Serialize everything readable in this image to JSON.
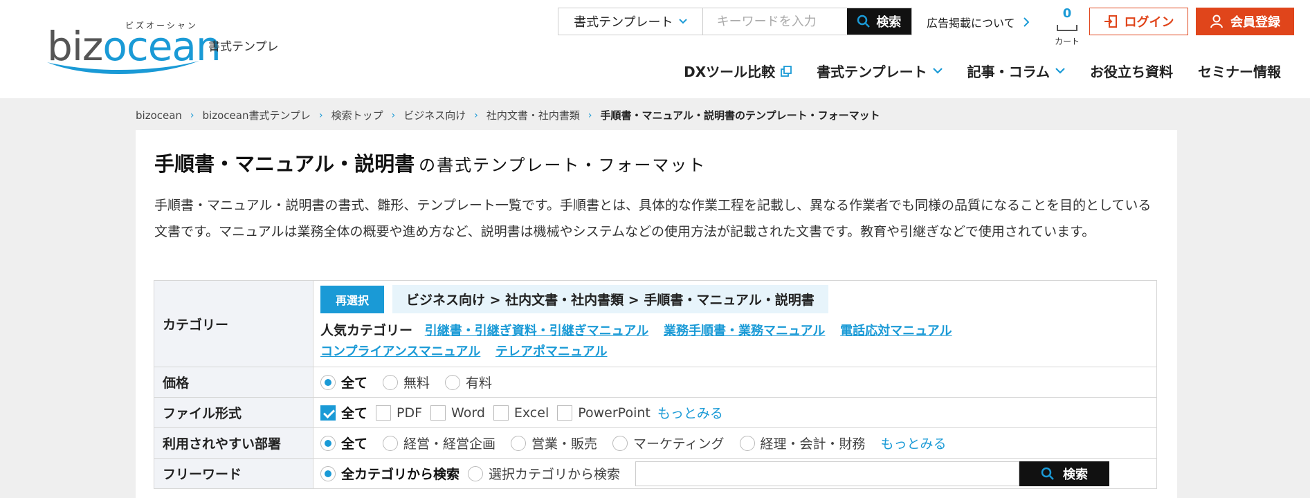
{
  "header": {
    "logo_kana": "ビズオーシャン",
    "logo_text_a": "biz",
    "logo_text_b": "ocean",
    "site_sub": "書式テンプレ",
    "search": {
      "select_label": "書式テンプレート",
      "placeholder": "キーワードを入力",
      "button_label": "検索"
    },
    "ad_link": "広告掲載について",
    "cart": {
      "count": "0",
      "label": "カート"
    },
    "login_label": "ログイン",
    "register_label": "会員登録",
    "nav": [
      {
        "label": "DXツール比較"
      },
      {
        "label": "書式テンプレート"
      },
      {
        "label": "記事・コラム"
      },
      {
        "label": "お役立ち資料"
      },
      {
        "label": "セミナー情報"
      }
    ]
  },
  "breadcrumb": [
    "bizocean",
    "bizocean書式テンプレ",
    "検索トップ",
    "ビジネス向け",
    "社内文書・社内書類",
    "手順書・マニュアル・説明書のテンプレート・フォーマット"
  ],
  "page": {
    "title": "手順書・マニュアル・説明書",
    "title_sub": "の書式テンプレート・フォーマット",
    "description": "手順書・マニュアル・説明書の書式、雛形、テンプレート一覧です。手順書とは、具体的な作業工程を記載し、異なる作業者でも同様の品質になることを目的としている文書です。マニュアルは業務全体の概要や進め方など、説明書は機械やシステムなどの使用方法が記載された文書です。教育や引継ぎなどで使用されています。"
  },
  "filters": {
    "category": {
      "label": "カテゴリー",
      "reselect": "再選択",
      "path": "ビジネス向け > 社内文書・社内書類 > 手順書・マニュアル・説明書",
      "popular_label": "人気カテゴリー",
      "popular": [
        "引継書・引継ぎ資料・引継ぎマニュアル",
        "業務手順書・業務マニュアル",
        "電話応対マニュアル",
        "コンプライアンスマニュアル",
        "テレアポマニュアル"
      ]
    },
    "price": {
      "label": "価格",
      "options": [
        "全て",
        "無料",
        "有料"
      ],
      "selected": 0
    },
    "file_format": {
      "label": "ファイル形式",
      "options": [
        "全て",
        "PDF",
        "Word",
        "Excel",
        "PowerPoint"
      ],
      "checked": [
        0
      ],
      "more": "もっとみる"
    },
    "department": {
      "label": "利用されやすい部署",
      "options": [
        "全て",
        "経営・経営企画",
        "営業・販売",
        "マーケティング",
        "経理・会計・財務"
      ],
      "selected": 0,
      "more": "もっとみる"
    },
    "freeword": {
      "label": "フリーワード",
      "options": [
        "全カテゴリから検索",
        "選択カテゴリから検索"
      ],
      "selected": 0,
      "input_value": "",
      "button_label": "検索"
    }
  },
  "colors": {
    "accent": "#1a9ad6",
    "brand_red": "#e0451b"
  }
}
